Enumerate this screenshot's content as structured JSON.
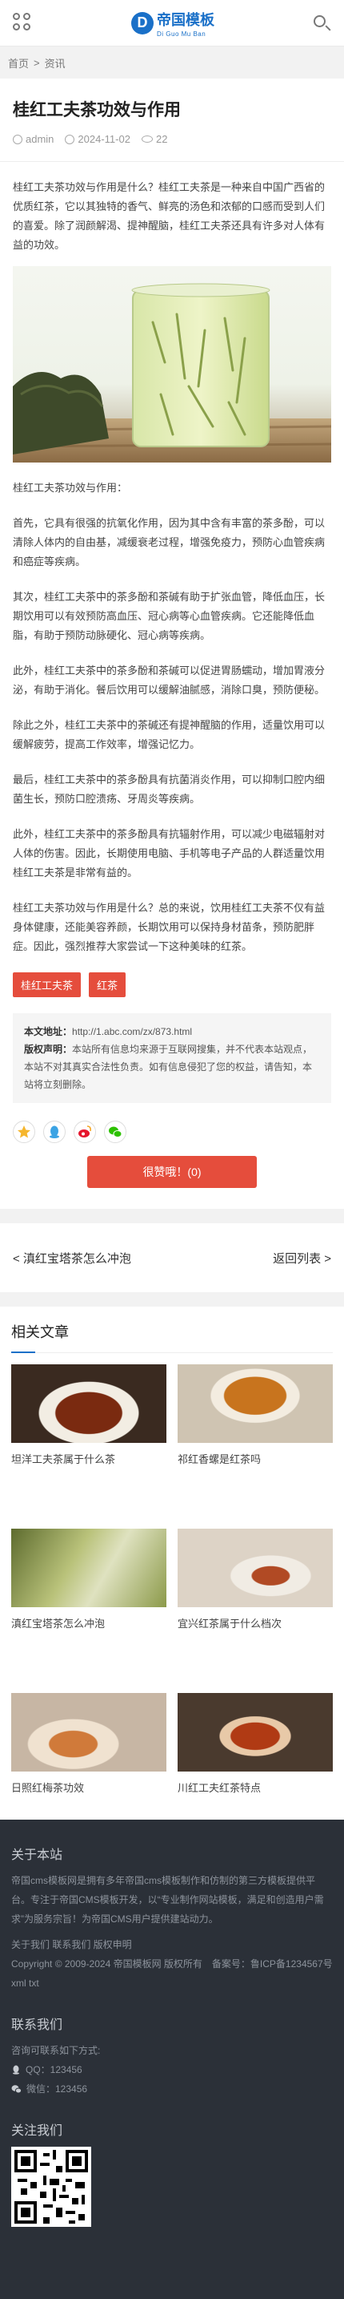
{
  "header": {
    "logo_mark": "D",
    "logo_cn": "帝国模板",
    "logo_en": "Di Guo Mu Ban"
  },
  "breadcrumb": {
    "home": "首页",
    "sep": ">",
    "section": "资讯"
  },
  "article": {
    "title": "桂红工夫茶功效与作用",
    "author": "admin",
    "date": "2024-11-02",
    "views": "22",
    "paragraphs": [
      "桂红工夫茶功效与作用是什么？桂红工夫茶是一种来自中国广西省的优质红茶，它以其独特的香气、鲜亮的汤色和浓郁的口感而受到人们的喜爱。除了润颜解渴、提神醒脑，桂红工夫茶还具有许多对人体有益的功效。",
      "桂红工夫茶功效与作用：",
      "首先，它具有很强的抗氧化作用，因为其中含有丰富的茶多酚，可以清除人体内的自由基，减缓衰老过程，增强免疫力，预防心血管疾病和癌症等疾病。",
      "其次，桂红工夫茶中的茶多酚和茶碱有助于扩张血管，降低血压，长期饮用可以有效预防高血压、冠心病等心血管疾病。它还能降低血脂，有助于预防动脉硬化、冠心病等疾病。",
      "此外，桂红工夫茶中的茶多酚和茶碱可以促进胃肠蠕动，增加胃液分泌，有助于消化。餐后饮用可以缓解油腻感，消除口臭，预防便秘。",
      "除此之外，桂红工夫茶中的茶碱还有提神醒脑的作用，适量饮用可以缓解疲劳，提高工作效率，增强记忆力。",
      "最后，桂红工夫茶中的茶多酚具有抗菌消炎作用，可以抑制口腔内细菌生长，预防口腔溃疡、牙周炎等疾病。",
      "此外，桂红工夫茶中的茶多酚具有抗辐射作用，可以减少电磁辐射对人体的伤害。因此，长期使用电脑、手机等电子产品的人群适量饮用桂红工夫茶是非常有益的。",
      "桂红工夫茶功效与作用是什么？总的来说，饮用桂红工夫茶不仅有益身体健康，还能美容养颜，长期饮用可以保持身材苗条，预防肥胖症。因此，强烈推荐大家尝试一下这种美味的红茶。"
    ],
    "tags": [
      "桂红工夫茶",
      "红茶"
    ],
    "info": {
      "url_label": "本文地址：",
      "url": "http://1.abc.com/zx/873.html",
      "copyright_label": "版权声明：",
      "copyright": "本站所有信息均来源于互联网搜集，并不代表本站观点，本站不对其真实合法性负责。如有信息侵犯了您的权益，请告知，本站将立刻删除。"
    },
    "like_label": "很赞哦！(0)"
  },
  "nav": {
    "prev": "< 滇红宝塔茶怎么冲泡",
    "back": "返回列表 >"
  },
  "related": {
    "title": "相关文章",
    "items": [
      {
        "caption": "坦洋工夫茶属于什么茶"
      },
      {
        "caption": "祁红香螺是红茶吗"
      },
      {
        "caption": "滇红宝塔茶怎么冲泡"
      },
      {
        "caption": "宜兴红茶属于什么档次"
      },
      {
        "caption": "日照红梅茶功效"
      },
      {
        "caption": "川红工夫红茶特点"
      }
    ]
  },
  "footer": {
    "about_title": "关于本站",
    "about_text": "帝国cms模板网是拥有多年帝国cms模板制作和仿制的第三方模板提供平台。专注于帝国CMS模板开发，以“专业制作网站模板，满足和创造用户需求”为服务宗旨！为帝国CMS用户提供建站动力。",
    "links": "关于我们 联系我们 版权申明",
    "copyright": "Copyright © 2009-2024 帝国模板网 版权所有　备案号：鲁ICP备1234567号",
    "xml": "xml txt",
    "contact_title": "联系我们",
    "contact_lead": "咨询可联系如下方式:",
    "qq": "QQ：123456",
    "wechat": "微信：123456",
    "follow_title": "关注我们"
  },
  "colors": {
    "accent": "#1a70c8",
    "tag_red": "#e54d3c",
    "footer_bg": "#2b3038"
  }
}
